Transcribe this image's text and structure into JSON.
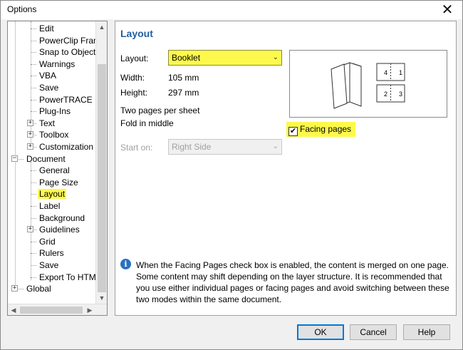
{
  "window": {
    "title": "Options",
    "close_glyph": "✕"
  },
  "tree": {
    "items": [
      {
        "label": "Edit",
        "name": "tree-item-edit",
        "expander": ""
      },
      {
        "label": "PowerClip Frame",
        "name": "tree-item-powerclip-frame",
        "expander": ""
      },
      {
        "label": "Snap to Objects",
        "name": "tree-item-snap-to-objects",
        "expander": ""
      },
      {
        "label": "Warnings",
        "name": "tree-item-warnings",
        "expander": ""
      },
      {
        "label": "VBA",
        "name": "tree-item-vba",
        "expander": ""
      },
      {
        "label": "Save",
        "name": "tree-item-save",
        "expander": ""
      },
      {
        "label": "PowerTRACE",
        "name": "tree-item-powertrace",
        "expander": ""
      },
      {
        "label": "Plug-Ins",
        "name": "tree-item-plug-ins",
        "expander": ""
      },
      {
        "label": "Text",
        "name": "tree-item-text",
        "expander": "+"
      },
      {
        "label": "Toolbox",
        "name": "tree-item-toolbox",
        "expander": "+"
      },
      {
        "label": "Customization",
        "name": "tree-item-customization",
        "expander": "+"
      },
      {
        "label": "Document",
        "name": "tree-item-document",
        "expander": "−"
      },
      {
        "label": "General",
        "name": "tree-item-general",
        "expander": ""
      },
      {
        "label": "Page Size",
        "name": "tree-item-page-size",
        "expander": ""
      },
      {
        "label": "Layout",
        "name": "tree-item-layout",
        "expander": "",
        "selected": true
      },
      {
        "label": "Label",
        "name": "tree-item-label",
        "expander": ""
      },
      {
        "label": "Background",
        "name": "tree-item-background",
        "expander": ""
      },
      {
        "label": "Guidelines",
        "name": "tree-item-guidelines",
        "expander": "+"
      },
      {
        "label": "Grid",
        "name": "tree-item-grid",
        "expander": ""
      },
      {
        "label": "Rulers",
        "name": "tree-item-rulers",
        "expander": ""
      },
      {
        "label": "Save",
        "name": "tree-item-document-save",
        "expander": ""
      },
      {
        "label": "Export To HTML",
        "name": "tree-item-export-to-html",
        "expander": ""
      },
      {
        "label": "Global",
        "name": "tree-item-global",
        "expander": "+"
      }
    ]
  },
  "content": {
    "heading": "Layout",
    "layout_label": "Layout:",
    "layout_value": "Booklet",
    "width_label": "Width:",
    "width_value": "105 mm",
    "height_label": "Height:",
    "height_value": "297 mm",
    "desc_line1": "Two pages per sheet",
    "desc_line2": "Fold in middle",
    "start_on_label": "Start on:",
    "start_on_value": "Right Side",
    "facing_pages_label": "Facing pages",
    "facing_pages_checked": true,
    "preview_pages": [
      "4",
      "1",
      "2",
      "3"
    ],
    "info_text": "When the Facing Pages check box is enabled, the content is merged on one page. Some content may shift depending on the layer structure. It is recommended that you use either individual pages or facing pages and avoid switching between these two modes within the same document."
  },
  "buttons": {
    "ok": "OK",
    "cancel": "Cancel",
    "help": "Help"
  },
  "colors": {
    "highlight": "#fdf94c",
    "heading": "#1f5f9e",
    "info_icon": "#2b6fc0"
  }
}
